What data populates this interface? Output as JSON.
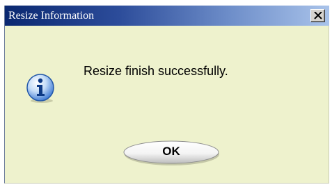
{
  "window": {
    "title": "Resize Information",
    "close_icon": "close-x-icon"
  },
  "dialog": {
    "icon": "info-icon",
    "message": "Resize finish successfully.",
    "ok_label": "OK"
  },
  "colors": {
    "titlebar_start": "#0a2870",
    "titlebar_end": "#a9c3ea",
    "dialog_background": "#eef2cd",
    "icon_blue": "#2f6fd0"
  }
}
